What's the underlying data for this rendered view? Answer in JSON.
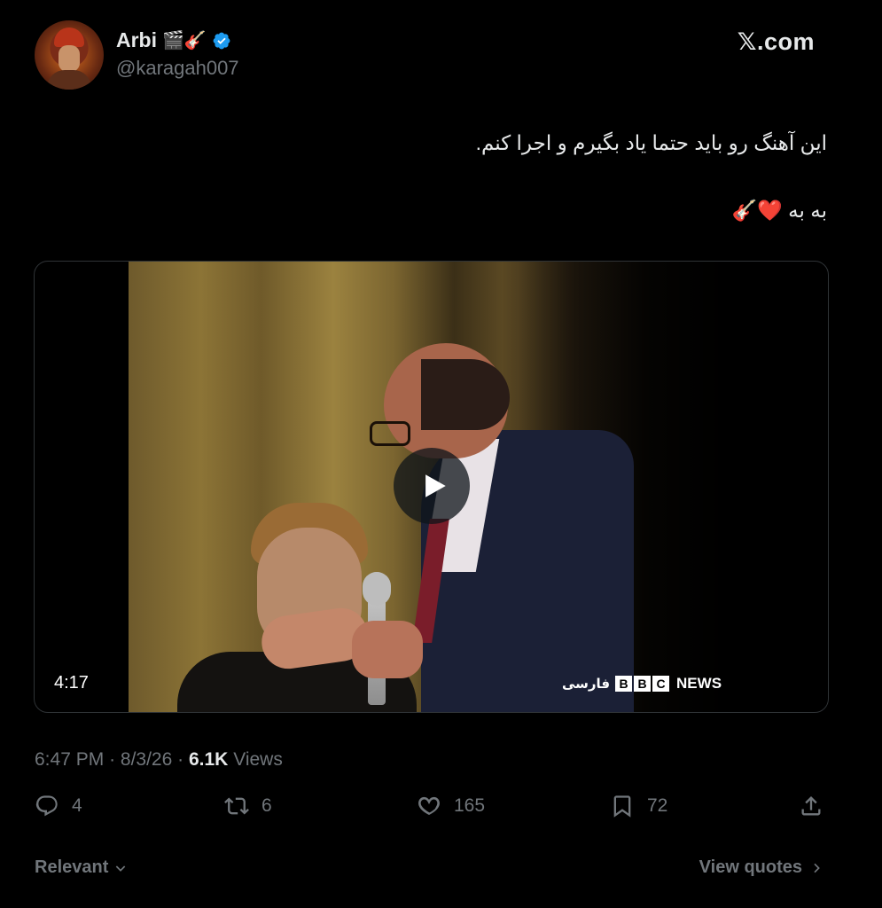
{
  "author": {
    "name": "Arbi",
    "name_emojis": "🎬🎸",
    "handle": "@karagah007",
    "verified": true
  },
  "site": "𝕏.com",
  "tweet": {
    "line1": "این آهنگ رو باید حتما یاد بگیرم و اجرا کنم.",
    "line2": "به به ❤️🎸"
  },
  "media": {
    "duration": "4:17",
    "watermark_farsi": "فارسی",
    "watermark_letters": [
      "B",
      "B",
      "C"
    ],
    "watermark_news": "NEWS"
  },
  "meta": {
    "time": "6:47 PM",
    "separator": "·",
    "date": "8/3/26",
    "views_count": "6.1K",
    "views_label": "Views"
  },
  "actions": {
    "replies": "4",
    "retweets": "6",
    "likes": "165",
    "bookmarks": "72"
  },
  "footer": {
    "sort_label": "Relevant",
    "view_quotes": "View quotes"
  },
  "colors": {
    "background": "#000000",
    "text": "#e7e9ea",
    "muted": "#71767b",
    "verified": "#1d9bf0",
    "border": "#2f3336"
  }
}
